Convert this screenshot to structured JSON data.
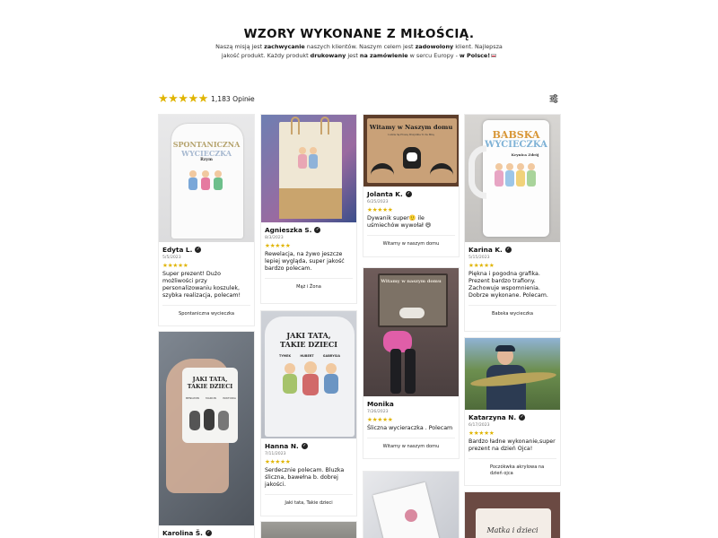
{
  "header": {
    "title": "WZORY WYKONANE Z MIŁOŚCIĄ.",
    "subtitle_parts": [
      {
        "text": "Naszą misją jest ",
        "bold": false
      },
      {
        "text": "zachwycanie",
        "bold": true
      },
      {
        "text": " naszych klientów. Naszym celem jest ",
        "bold": false
      },
      {
        "text": "zadowolony",
        "bold": true
      },
      {
        "text": " klient. Najlepsza jakość produkt. Każdy produkt ",
        "bold": false
      },
      {
        "text": "drukowany",
        "bold": true
      },
      {
        "text": " jest ",
        "bold": false
      },
      {
        "text": "na zamówienie",
        "bold": true
      },
      {
        "text": " w sercu Europy - ",
        "bold": false
      },
      {
        "text": "w Polsce!",
        "bold": true
      }
    ]
  },
  "toolbar": {
    "stars": "★★★★★",
    "review_count": "1,183 Opinie",
    "chevron_icon": "chevron-down-icon",
    "filter_icon": "sliders-icon"
  },
  "reviews": [
    {
      "name": "Edyta L.",
      "date": "5/5/2023",
      "stars": "★★★★★",
      "text": "Super prezent! Dużo możliwości przy personalizowaniu koszulek, szybka realizacja, polecam!",
      "product": "Spontaniczna wycieczka",
      "image_lines": [
        "SPONTANICZNA",
        "WYCIECZKA",
        "Rzym"
      ]
    },
    {
      "name": "Agnieszka S.",
      "date": "8/3/2023",
      "stars": "★★★★★",
      "text": "Rewelacja,  na żywo jeszcze lepiej wygląda, super jakość   bardzo polecam.",
      "product": "Mąż i Żona"
    },
    {
      "name": "Jolanta K.",
      "date": "6/25/2023",
      "stars": "★★★★★",
      "text": "Dywanik super🙂 ile uśmiechów wywołał 😄",
      "product": "Witamy w naszym domu",
      "image_lines": [
        "Witamy w Naszym domu",
        "Ludzie Są Proszę Wszystkie To Ze Mną"
      ]
    },
    {
      "name": "Karina K.",
      "date": "5/15/2023",
      "stars": "★★★★★",
      "text": "Piękna i pogodna grafika. Prezent bardzo trafiony. Zachowuje wspomnienia. Dobrze wykonane. Polecam.",
      "product": "Babska wycieczka",
      "image_lines": [
        "BABSKA",
        "WYCIECZKA",
        "Krynica Zdrój"
      ]
    },
    {
      "name": "Monika",
      "date": "7/26/2023",
      "stars": "★★★★★",
      "text": "Śliczna wycieraczka . Polecam",
      "product": "Witamy w naszym domu",
      "image_lines": [
        "Witamy w naszym domu"
      ]
    },
    {
      "name": "Hanna N.",
      "date": "7/11/2023",
      "stars": "★★★★★",
      "text": "Serdecznie polecam. Bluzka śliczna, bawełna b. dobrej jakości.",
      "product": "Jaki tata, Takie dzieci",
      "image_lines": [
        "JAKI TATA,",
        "TAKIE DZIECI",
        "TYMEK",
        "HUBERT",
        "GABRYSIA"
      ]
    },
    {
      "name": "Katarzyna N.",
      "date": "6/17/2023",
      "stars": "★★★★★",
      "text": "Bardzo ładne wykonanie,super prezent na dzień Ojca!",
      "product": "Poczókwka akrylowa na dzień ojca"
    },
    {
      "name": "Karolina Š.",
      "image_lines": [
        "JAKI TATA,",
        "TAKIE DZIECI",
        "BENIAMIN",
        "MARCIN",
        "WIKTORIA"
      ]
    },
    {
      "image_lines": [
        "Matka i dzieci"
      ]
    }
  ],
  "colors": {
    "star": "#e0b400",
    "text": "#111111",
    "muted": "#777777",
    "border": "#ececec"
  }
}
